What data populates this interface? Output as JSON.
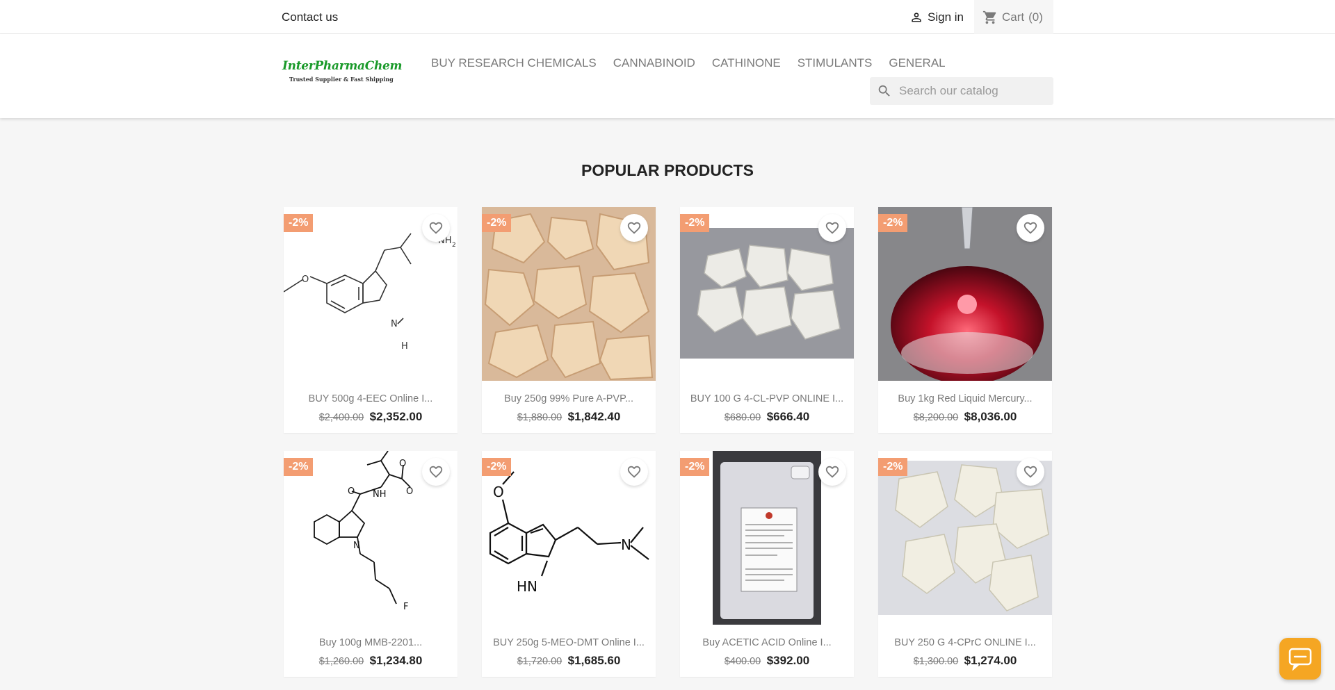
{
  "topbar": {
    "contact_label": "Contact us",
    "signin_label": "Sign in",
    "cart_label": "Cart",
    "cart_count": "(0)"
  },
  "header": {
    "logo_name": "InterPharmaChem",
    "logo_tagline": "Trusted Supplier & Fast Shipping",
    "nav": [
      "BUY RESEARCH CHEMICALS",
      "CANNABINOID",
      "CATHINONE",
      "STIMULANTS",
      "GENERAL"
    ],
    "search_placeholder": "Search our catalog"
  },
  "section_title": "POPULAR PRODUCTS",
  "products": [
    {
      "badge": "-2%",
      "name": "BUY 500g 4-EEC Online I...",
      "old_price": "$2,400.00",
      "price": "$2,352.00",
      "image": "molecule-5-methoxy-amt"
    },
    {
      "badge": "-2%",
      "name": "Buy 250g 99% Pure A-PVP...",
      "old_price": "$1,880.00",
      "price": "$1,842.40",
      "image": "tan-crystals"
    },
    {
      "badge": "-2%",
      "name": "BUY 100 G 4-CL-PVP ONLINE I...",
      "old_price": "$680.00",
      "price": "$666.40",
      "image": "crystals-in-bag"
    },
    {
      "badge": "-2%",
      "name": "Buy 1kg Red Liquid Mercury...",
      "old_price": "$8,200.00",
      "price": "$8,036.00",
      "image": "red-liquid-drop"
    },
    {
      "badge": "-2%",
      "name": "Buy 100g MMB-2201...",
      "old_price": "$1,260.00",
      "price": "$1,234.80",
      "image": "molecule-mmb"
    },
    {
      "badge": "-2%",
      "name": "BUY 250g 5-MEO-DMT Online I...",
      "old_price": "$1,720.00",
      "price": "$1,685.60",
      "image": "molecule-5-meo-dmt"
    },
    {
      "badge": "-2%",
      "name": "Buy ACETIC ACID Online I...",
      "old_price": "$400.00",
      "price": "$392.00",
      "image": "jerrycan"
    },
    {
      "badge": "-2%",
      "name": "BUY 250 G 4-CPrC ONLINE I...",
      "old_price": "$1,300.00",
      "price": "$1,274.00",
      "image": "white-crystals"
    }
  ],
  "colors": {
    "badge": "#f39d72",
    "logo_green": "#1a9a2a",
    "chat": "#f5a623"
  }
}
